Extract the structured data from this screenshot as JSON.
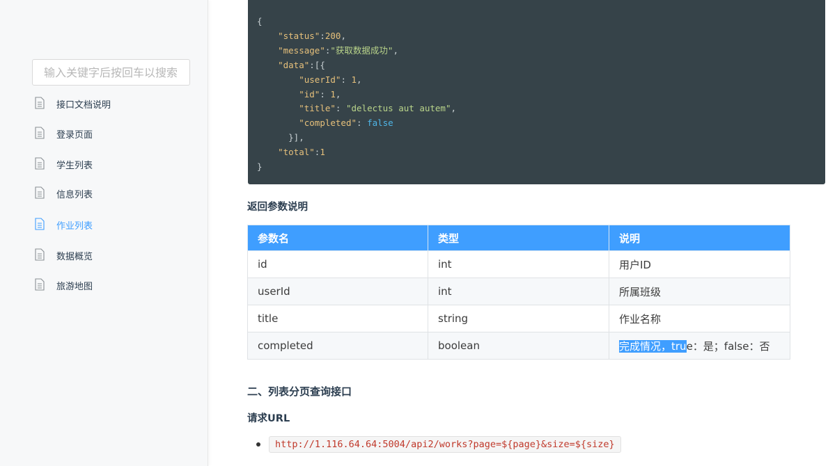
{
  "sidebar": {
    "search_placeholder": "输入关键字后按回车以搜索",
    "items": [
      {
        "label": "接口文档说明",
        "icon": "document-icon",
        "active": false
      },
      {
        "label": "登录页面",
        "icon": "document-icon",
        "active": false
      },
      {
        "label": "学生列表",
        "icon": "document-icon",
        "active": false
      },
      {
        "label": "信息列表",
        "icon": "document-icon",
        "active": false
      },
      {
        "label": "作业列表",
        "icon": "document-icon",
        "active": true
      },
      {
        "label": "数据概览",
        "icon": "document-icon",
        "active": false
      },
      {
        "label": "旅游地图",
        "icon": "document-icon",
        "active": false
      }
    ]
  },
  "code": {
    "lines": [
      "{",
      "    \"status\":200,",
      "    \"message\":\"获取数据成功\",",
      "    \"data\":[{",
      "        \"userId\": 1,",
      "        \"id\": 1,",
      "        \"title\": \"delectus aut autem\",",
      "        \"completed\": false",
      "      }],",
      "    \"total\":1",
      "}"
    ]
  },
  "return_section": {
    "title": "返回参数说明",
    "headers": [
      "参数名",
      "类型",
      "说明"
    ],
    "rows": [
      [
        "id",
        "int",
        "用户ID"
      ],
      [
        "userId",
        "int",
        "所属班级"
      ],
      [
        "title",
        "string",
        "作业名称"
      ],
      [
        "completed",
        "boolean",
        "完成情况，true：是；false：否"
      ]
    ],
    "selected_text": "完成情况，tru",
    "after_selection": "e：是；false：否"
  },
  "section2": {
    "title": "二、列表分页查询接口",
    "url_heading": "请求URL",
    "url": "http://1.116.64.64:5004/api2/works?page=${page}&size=${size}"
  },
  "colors": {
    "accent": "#3f9eff",
    "code_bg": "#364349",
    "url_red": "#c0392b"
  }
}
